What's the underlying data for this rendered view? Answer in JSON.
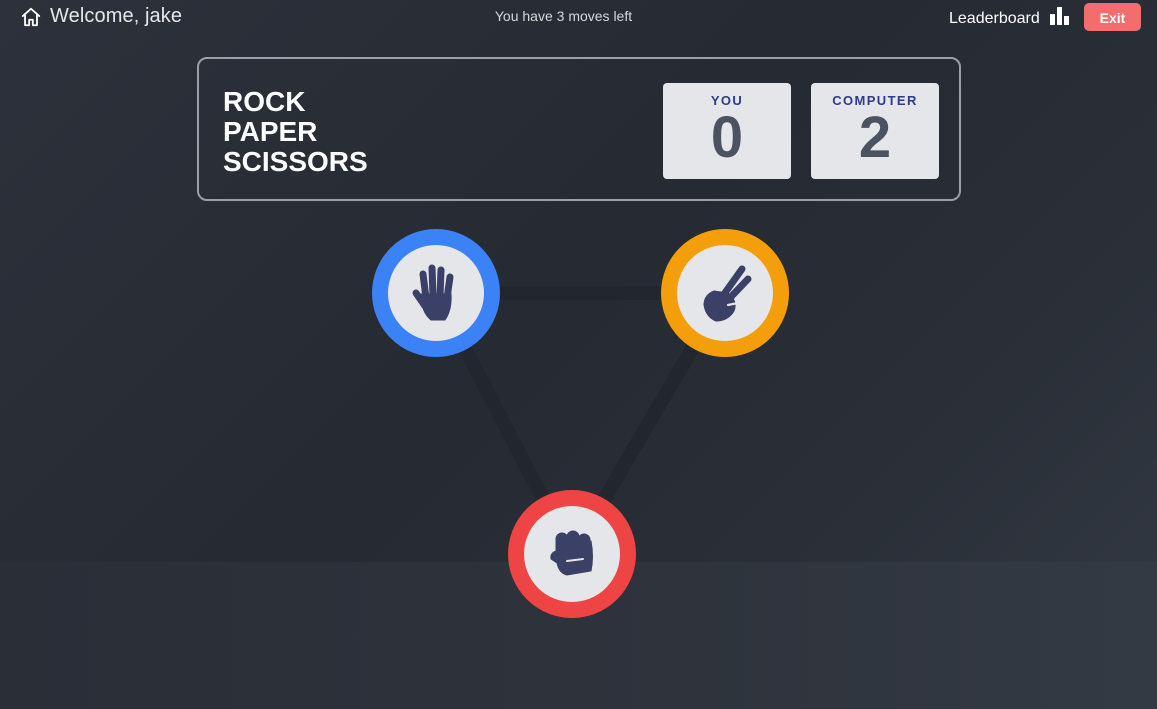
{
  "header": {
    "welcome": "Welcome, jake",
    "moves_text": "You have 3 moves left",
    "leaderboard_label": "Leaderboard",
    "exit_label": "Exit",
    "icons": {
      "home": "home-icon",
      "leaderboard": "bar-chart-icon"
    }
  },
  "scoreboard": {
    "title_lines": [
      "ROCK",
      "PAPER",
      "SCISSORS"
    ],
    "you_label": "YOU",
    "you_score": "0",
    "computer_label": "COMPUTER",
    "computer_score": "2"
  },
  "choices": [
    {
      "name": "paper",
      "icon": "open-hand-icon",
      "ring_color": "#3b82f6"
    },
    {
      "name": "scissors",
      "icon": "peace-hand-icon",
      "ring_color": "#f59e0b"
    },
    {
      "name": "rock",
      "icon": "fist-icon",
      "ring_color": "#ef4444"
    }
  ],
  "colors": {
    "exit_button": "#f26d6d",
    "score_label": "#2e3a8c",
    "hand_icon": "#3a4066",
    "connector": "#22262d"
  }
}
